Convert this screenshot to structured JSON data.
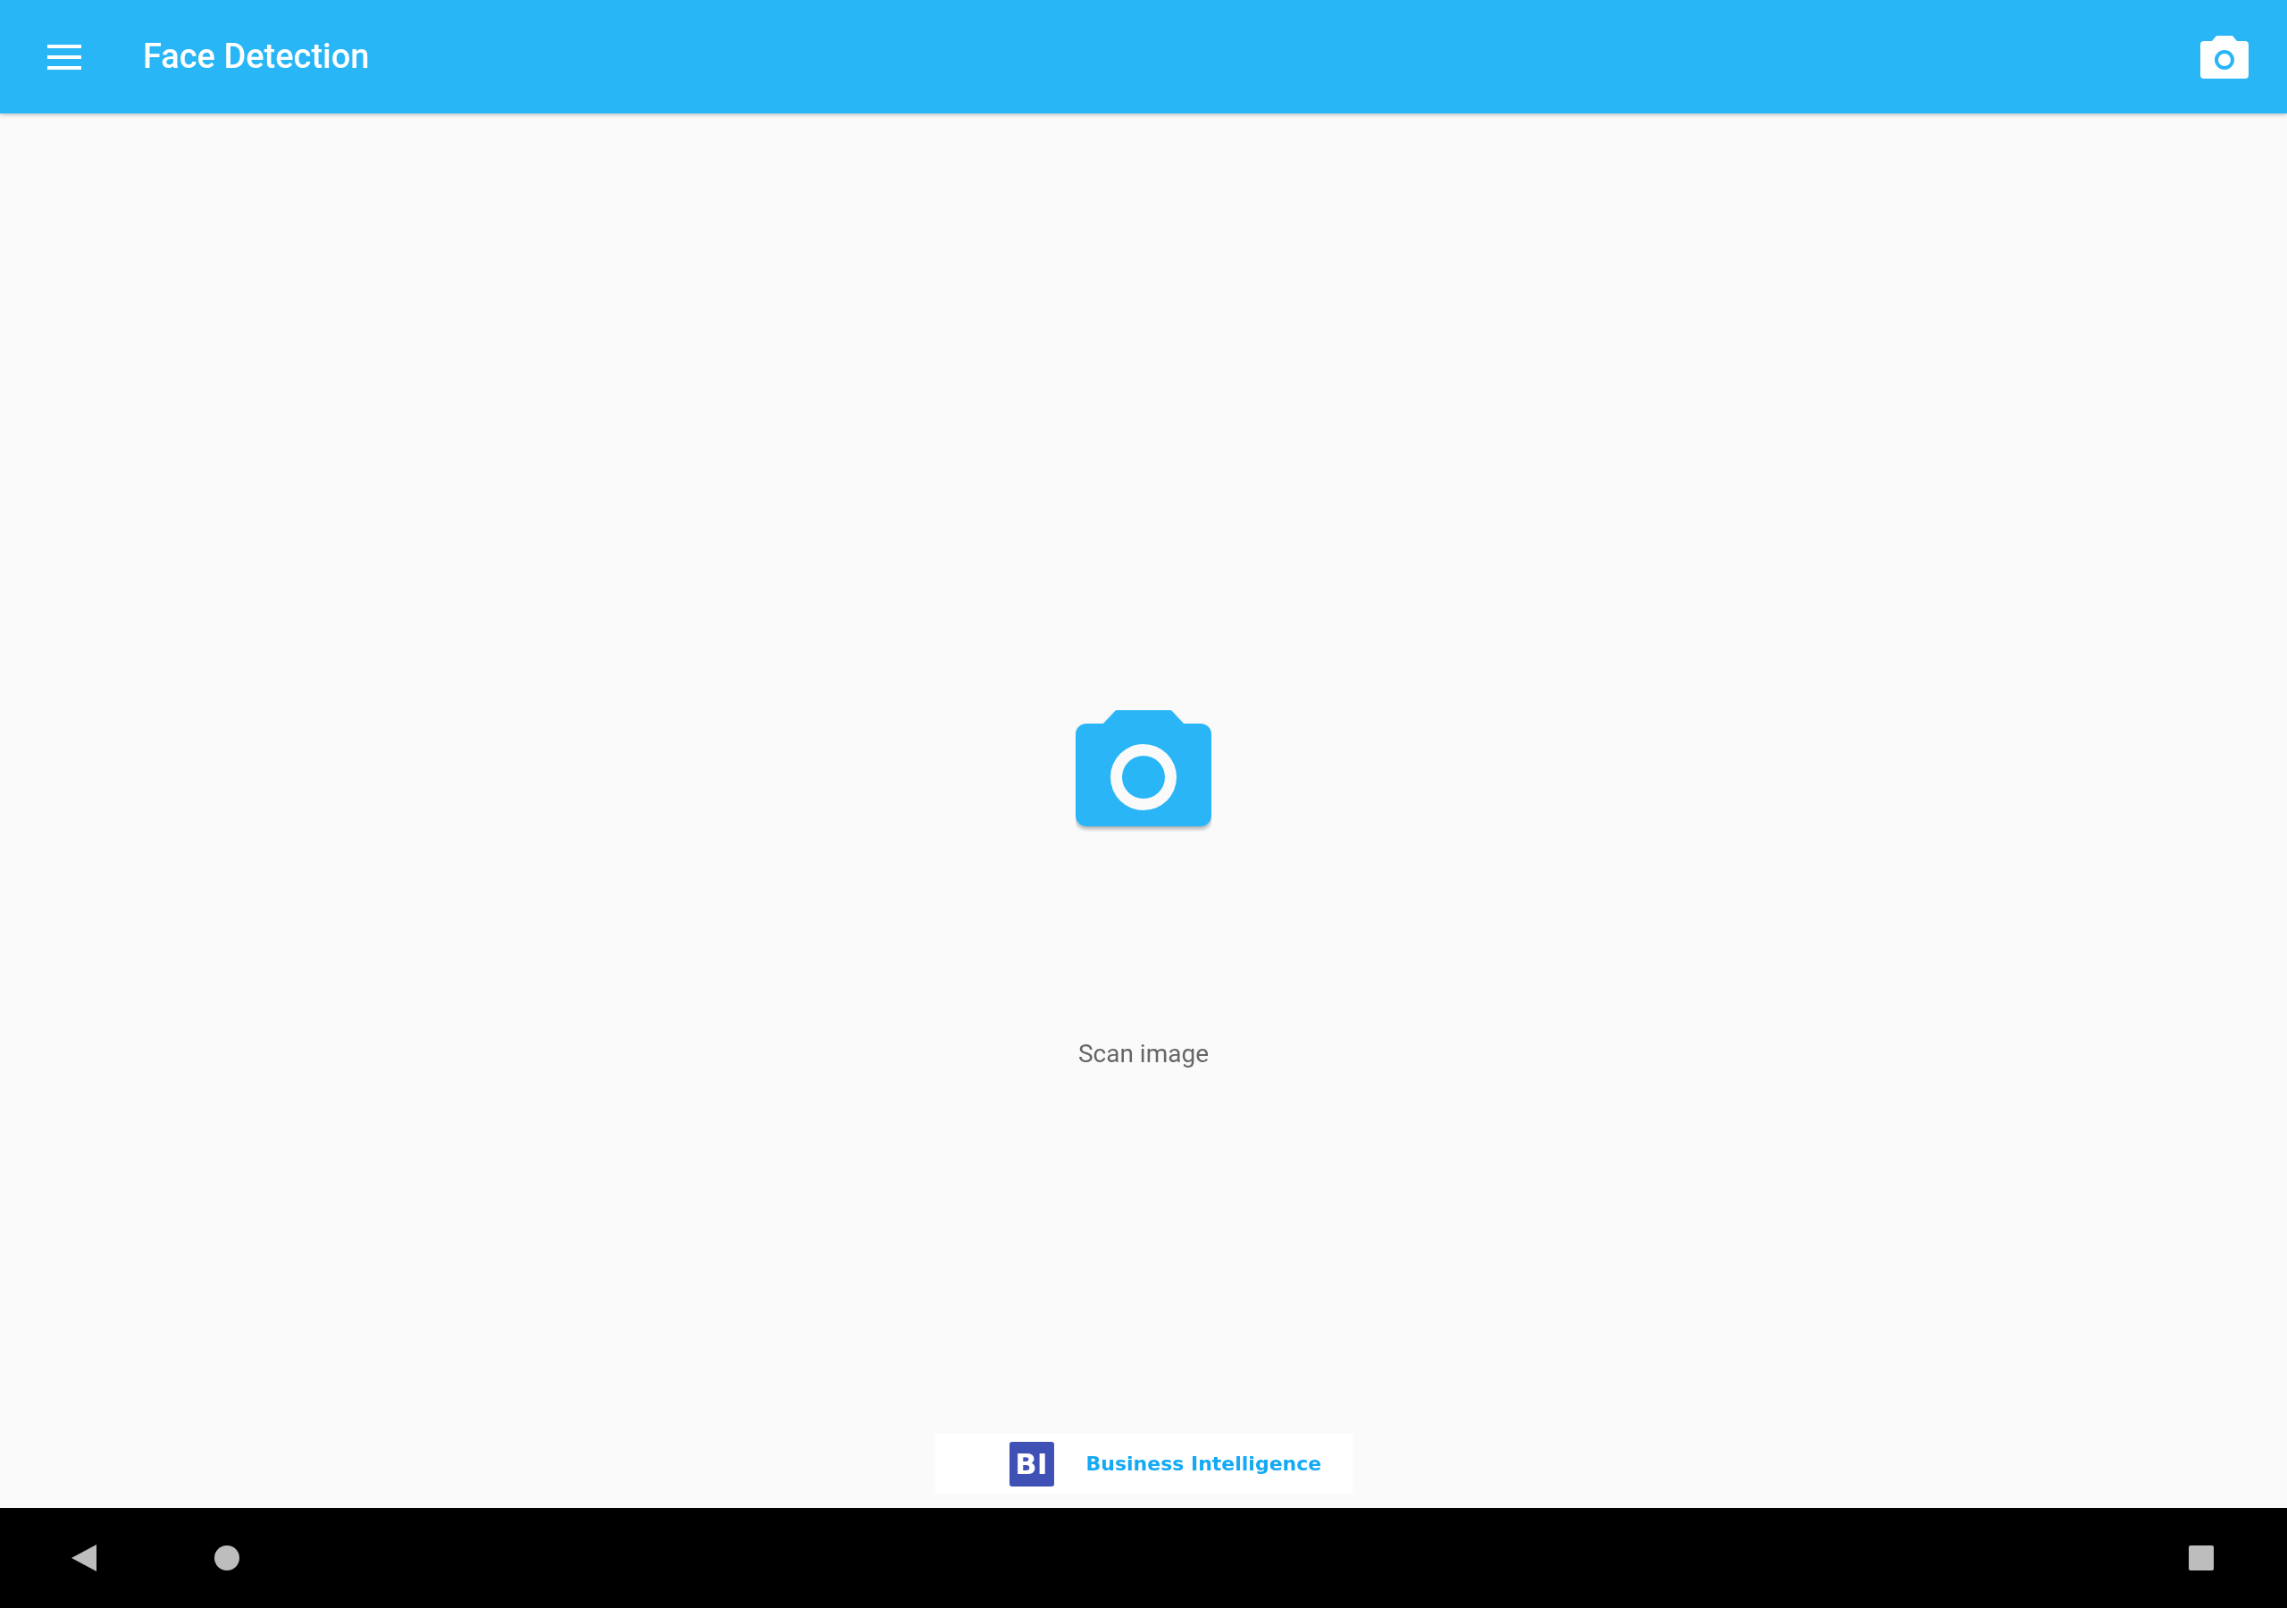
{
  "app_bar": {
    "title": "Face Detection"
  },
  "main": {
    "label": "Scan image"
  },
  "ad_banner": {
    "logo_text": "BI",
    "text": "Business Intelligence"
  }
}
